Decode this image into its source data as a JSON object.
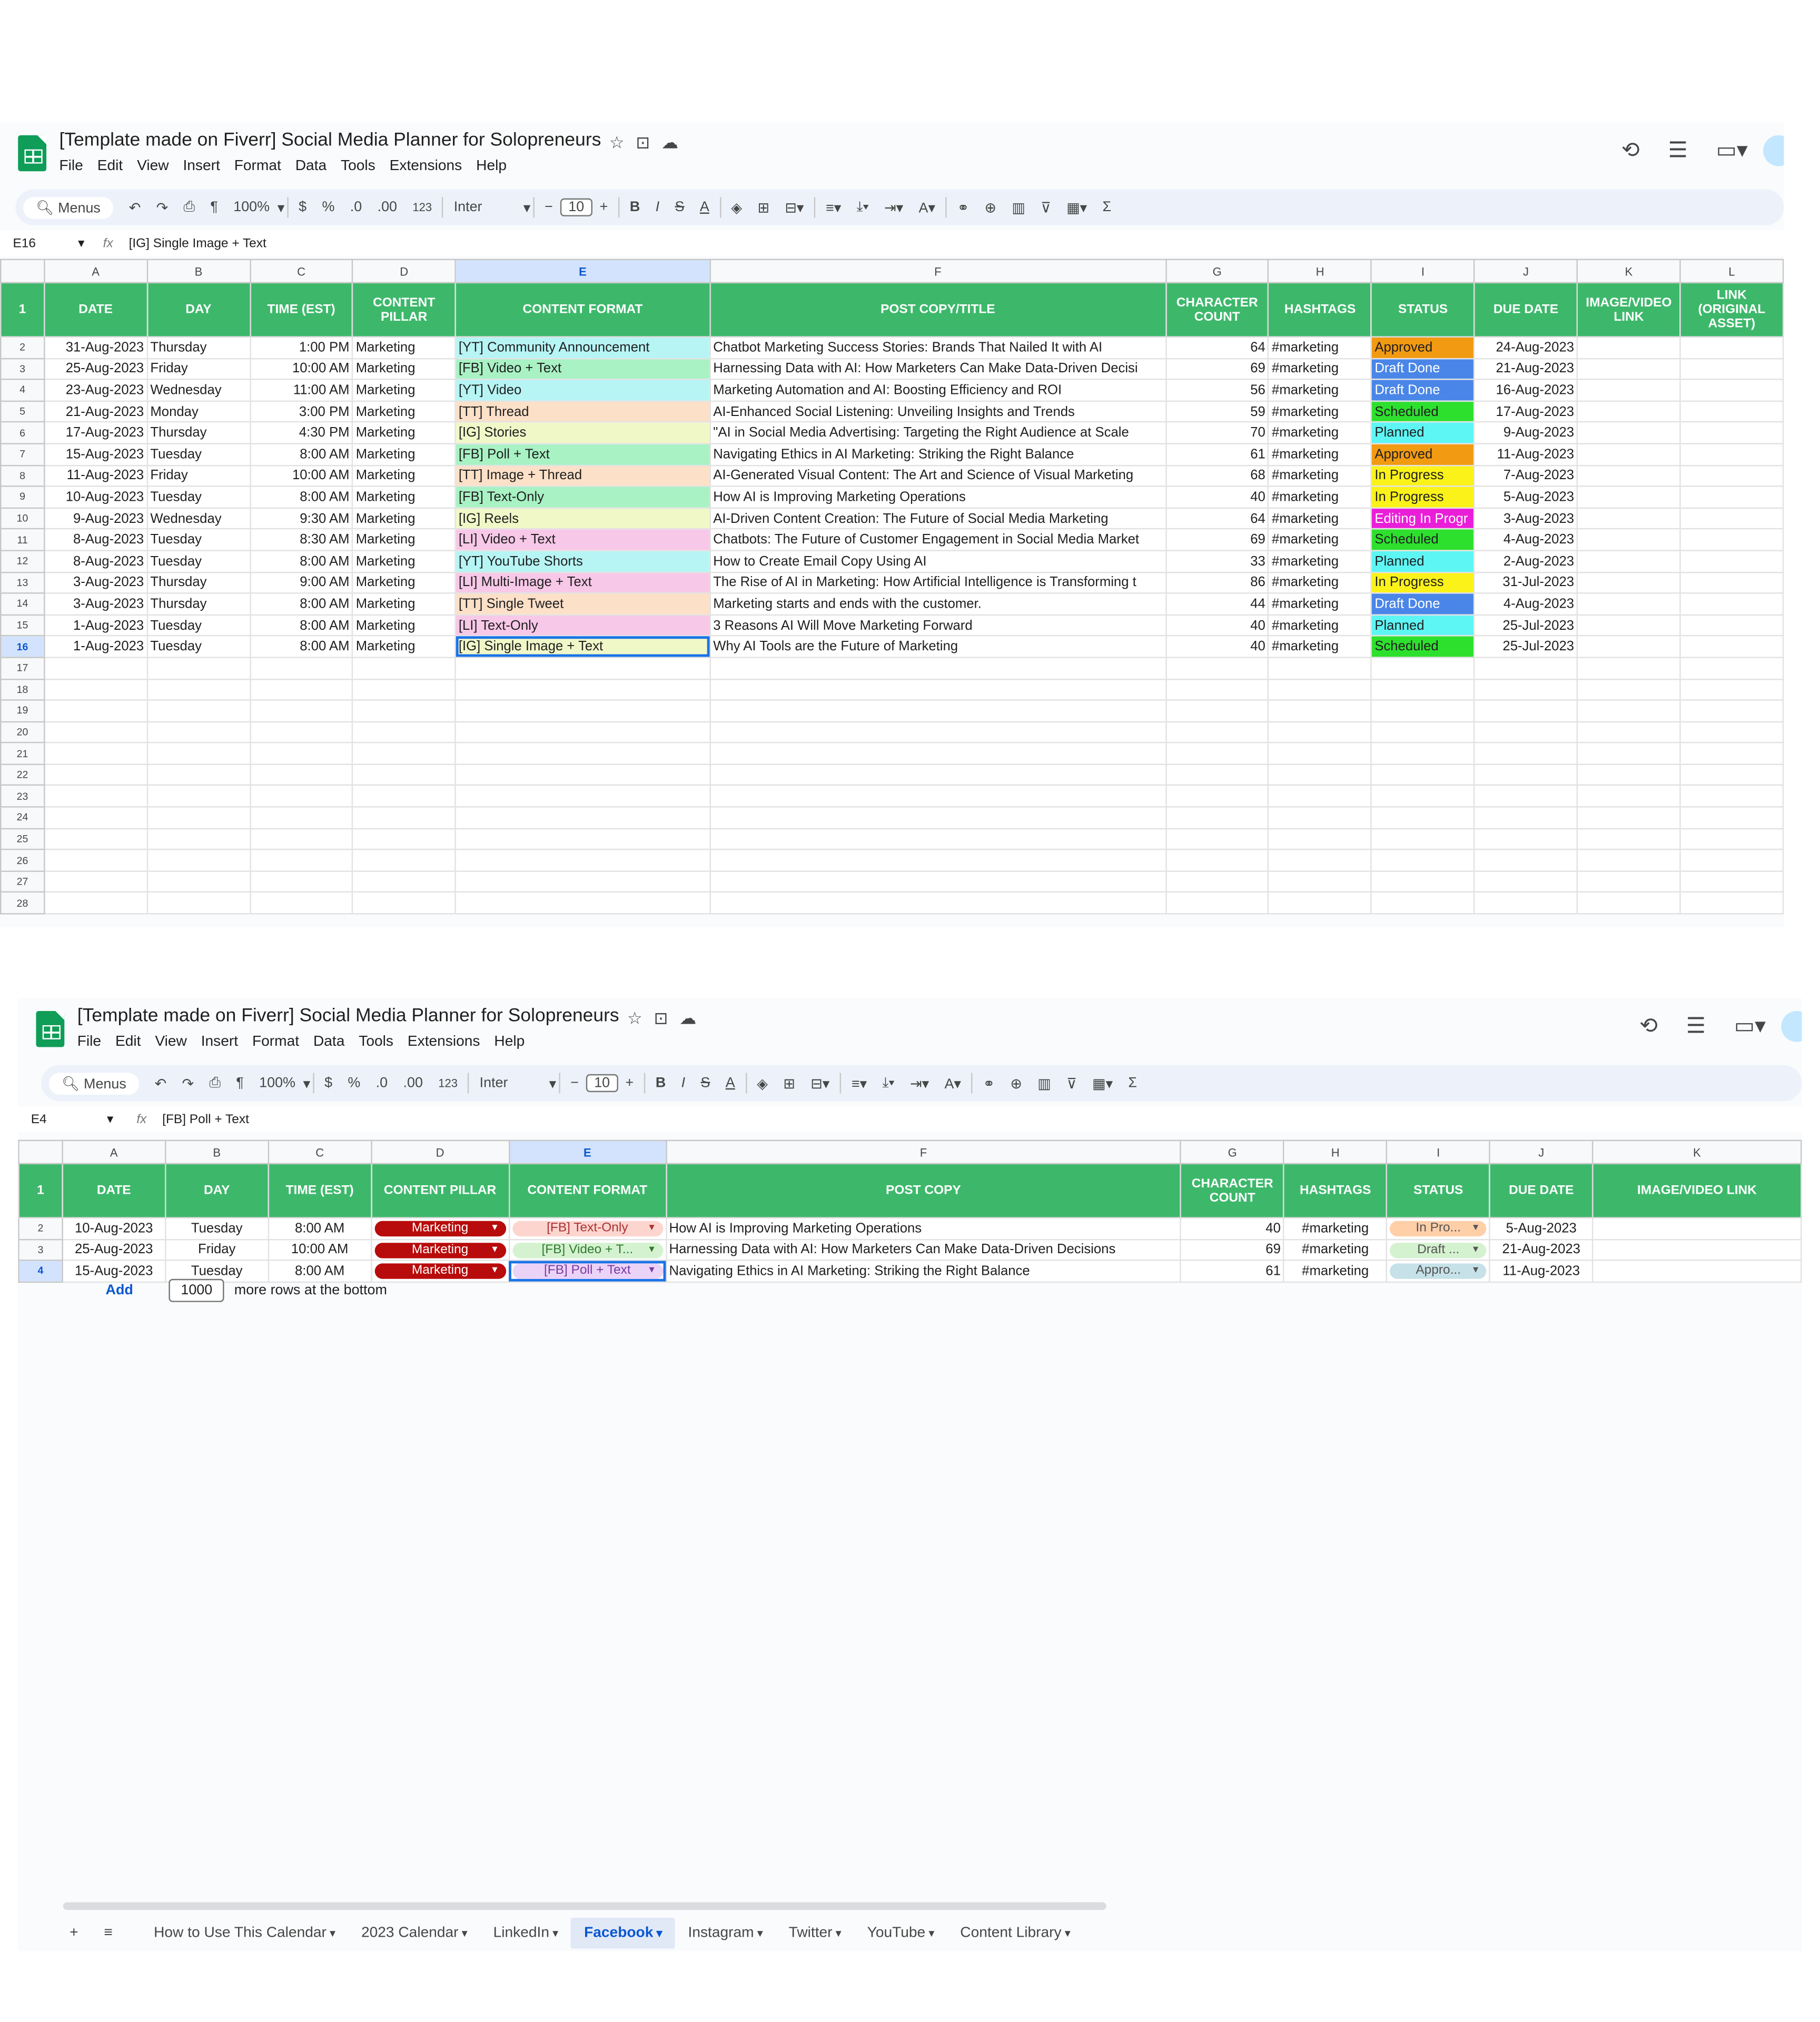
{
  "doc_title": "[Template made on Fiverr] Social Media Planner for Solopreneurs",
  "menu": [
    "File",
    "Edit",
    "View",
    "Insert",
    "Format",
    "Data",
    "Tools",
    "Extensions",
    "Help"
  ],
  "toolbar": {
    "search": "Menus",
    "zoom": "100%",
    "currency": "$",
    "percent": "%",
    "dec_less": ".0",
    "dec_more": ".00",
    "num_fmt": "123",
    "font": "Inter",
    "font_size": "10"
  },
  "icons": {
    "title": [
      "star-icon",
      "move-icon",
      "cloud-icon"
    ],
    "right": [
      "history-icon",
      "comment-icon",
      "video-icon"
    ],
    "logo": "sheets-logo"
  },
  "pane1": {
    "name_box": "E16",
    "formula": "[IG] Single Image + Text",
    "columns": [
      "A",
      "B",
      "C",
      "D",
      "E",
      "F",
      "G",
      "H",
      "I",
      "J",
      "K",
      "L"
    ],
    "headers": [
      "DATE",
      "DAY",
      "TIME (EST)",
      "CONTENT PILLAR",
      "CONTENT FORMAT",
      "POST COPY/TITLE",
      "CHARACTER COUNT",
      "HASHTAGS",
      "STATUS",
      "DUE DATE",
      "IMAGE/VIDEO LINK",
      "LINK (ORIGINAL ASSET)"
    ],
    "rows": [
      {
        "date": "31-Aug-2023",
        "day": "Thursday",
        "time": "1:00 PM",
        "pillar": "Marketing",
        "format": "[YT] Community Announcement",
        "copy": "Chatbot Marketing Success Stories: Brands That Nailed It with AI",
        "count": "64",
        "tags": "#marketing",
        "status": "Approved",
        "due": "24-Aug-2023"
      },
      {
        "date": "25-Aug-2023",
        "day": "Friday",
        "time": "10:00 AM",
        "pillar": "Marketing",
        "format": "[FB] Video + Text",
        "copy": "Harnessing Data with AI: How Marketers Can Make Data-Driven Decisi",
        "count": "69",
        "tags": "#marketing",
        "status": "Draft Done",
        "due": "21-Aug-2023"
      },
      {
        "date": "23-Aug-2023",
        "day": "Wednesday",
        "time": "11:00 AM",
        "pillar": "Marketing",
        "format": "[YT] Video",
        "copy": "Marketing Automation and AI: Boosting Efficiency and ROI",
        "count": "56",
        "tags": "#marketing",
        "status": "Draft Done",
        "due": "16-Aug-2023"
      },
      {
        "date": "21-Aug-2023",
        "day": "Monday",
        "time": "3:00 PM",
        "pillar": "Marketing",
        "format": "[TT] Thread",
        "copy": "AI-Enhanced Social Listening: Unveiling Insights and Trends",
        "count": "59",
        "tags": "#marketing",
        "status": "Scheduled",
        "due": "17-Aug-2023"
      },
      {
        "date": "17-Aug-2023",
        "day": "Thursday",
        "time": "4:30 PM",
        "pillar": "Marketing",
        "format": "[IG] Stories",
        "copy": "\"AI in Social Media Advertising: Targeting the Right Audience at Scale",
        "count": "70",
        "tags": "#marketing",
        "status": "Planned",
        "due": "9-Aug-2023"
      },
      {
        "date": "15-Aug-2023",
        "day": "Tuesday",
        "time": "8:00 AM",
        "pillar": "Marketing",
        "format": "[FB] Poll + Text",
        "copy": "Navigating Ethics in AI Marketing: Striking the Right Balance",
        "count": "61",
        "tags": "#marketing",
        "status": "Approved",
        "due": "11-Aug-2023"
      },
      {
        "date": "11-Aug-2023",
        "day": "Friday",
        "time": "10:00 AM",
        "pillar": "Marketing",
        "format": "[TT] Image + Thread",
        "copy": "AI-Generated Visual Content: The Art and Science of Visual Marketing",
        "count": "68",
        "tags": "#marketing",
        "status": "In Progress",
        "due": "7-Aug-2023"
      },
      {
        "date": "10-Aug-2023",
        "day": "Tuesday",
        "time": "8:00 AM",
        "pillar": "Marketing",
        "format": "[FB] Text-Only",
        "copy": "How AI is Improving Marketing Operations",
        "count": "40",
        "tags": "#marketing",
        "status": "In Progress",
        "due": "5-Aug-2023"
      },
      {
        "date": "9-Aug-2023",
        "day": "Wednesday",
        "time": "9:30 AM",
        "pillar": "Marketing",
        "format": "[IG] Reels",
        "copy": "AI-Driven Content Creation: The Future of Social Media Marketing",
        "count": "64",
        "tags": "#marketing",
        "status": "Editing In Progr",
        "due": "3-Aug-2023"
      },
      {
        "date": "8-Aug-2023",
        "day": "Tuesday",
        "time": "8:30 AM",
        "pillar": "Marketing",
        "format": "[LI] Video + Text",
        "copy": "Chatbots: The Future of Customer Engagement in Social Media Market",
        "count": "69",
        "tags": "#marketing",
        "status": "Scheduled",
        "due": "4-Aug-2023"
      },
      {
        "date": "8-Aug-2023",
        "day": "Tuesday",
        "time": "8:00 AM",
        "pillar": "Marketing",
        "format": "[YT] YouTube Shorts",
        "copy": "How to Create Email Copy Using AI",
        "count": "33",
        "tags": "#marketing",
        "status": "Planned",
        "due": "2-Aug-2023"
      },
      {
        "date": "3-Aug-2023",
        "day": "Thursday",
        "time": "9:00 AM",
        "pillar": "Marketing",
        "format": "[LI] Multi-Image + Text",
        "copy": "The Rise of AI in Marketing: How Artificial Intelligence is Transforming t",
        "count": "86",
        "tags": "#marketing",
        "status": "In Progress",
        "due": "31-Jul-2023"
      },
      {
        "date": "3-Aug-2023",
        "day": "Thursday",
        "time": "8:00 AM",
        "pillar": "Marketing",
        "format": "[TT] Single Tweet",
        "copy": "Marketing starts and ends with the customer.",
        "count": "44",
        "tags": "#marketing",
        "status": "Draft Done",
        "due": "4-Aug-2023"
      },
      {
        "date": "1-Aug-2023",
        "day": "Tuesday",
        "time": "8:00 AM",
        "pillar": "Marketing",
        "format": "[LI] Text-Only",
        "copy": "3 Reasons AI Will Move Marketing Forward",
        "count": "40",
        "tags": "#marketing",
        "status": "Planned",
        "due": "25-Jul-2023"
      },
      {
        "date": "1-Aug-2023",
        "day": "Tuesday",
        "time": "8:00 AM",
        "pillar": "Marketing",
        "format": "[IG] Single Image + Text",
        "copy": "Why AI Tools are the Future of Marketing",
        "count": "40",
        "tags": "#marketing",
        "status": "Scheduled",
        "due": "25-Jul-2023"
      }
    ],
    "empty_rows": [
      "17",
      "18",
      "19",
      "20",
      "21",
      "22",
      "23",
      "24",
      "25",
      "26",
      "27",
      "28"
    ],
    "format_colors": {
      "YT": "#b7f5f5",
      "FB": "#a8f2c4",
      "TT": "#fde0c8",
      "IG": "#f1f8c8",
      "LI": "#f8c8e8"
    },
    "status_colors": {
      "Approved": "#f29a12",
      "Draft Done": "#4a86e8",
      "Scheduled": "#2ee02e",
      "Planned": "#5ef5f5",
      "In Progress": "#fbf21a",
      "Editing In Progr": "#ea1ed8"
    }
  },
  "pane2": {
    "name_box": "E4",
    "formula": "[FB] Poll + Text",
    "columns": [
      "A",
      "B",
      "C",
      "D",
      "E",
      "F",
      "G",
      "H",
      "I",
      "J",
      "K"
    ],
    "headers": [
      "DATE",
      "DAY",
      "TIME (EST)",
      "CONTENT PILLAR",
      "CONTENT FORMAT",
      "POST COPY",
      "CHARACTER COUNT",
      "HASHTAGS",
      "STATUS",
      "DUE DATE",
      "IMAGE/VIDEO LINK"
    ],
    "rows": [
      {
        "date": "10-Aug-2023",
        "day": "Tuesday",
        "time": "8:00 AM",
        "pillar": "Marketing",
        "format": "[FB] Text-Only",
        "copy": "How AI is Improving Marketing Operations",
        "count": "40",
        "tags": "#marketing",
        "status": "In Pro...",
        "due": "5-Aug-2023"
      },
      {
        "date": "25-Aug-2023",
        "day": "Friday",
        "time": "10:00 AM",
        "pillar": "Marketing",
        "format": "[FB] Video + T...",
        "copy": "Harnessing Data with AI: How Marketers Can Make Data-Driven Decisions",
        "count": "69",
        "tags": "#marketing",
        "status": "Draft ...",
        "due": "21-Aug-2023"
      },
      {
        "date": "15-Aug-2023",
        "day": "Tuesday",
        "time": "8:00 AM",
        "pillar": "Marketing",
        "format": "[FB] Poll + Text",
        "copy": "Navigating Ethics in AI Marketing: Striking the Right Balance",
        "count": "61",
        "tags": "#marketing",
        "status": "Appro...",
        "due": "11-Aug-2023"
      }
    ],
    "format_chip_colors": [
      "#fdd5cf",
      "#d4f2cf",
      "#ebd3f7"
    ],
    "status_chip_colors": [
      "#ffcfa8",
      "#d4f2cf",
      "#c6e2e8"
    ],
    "pillar_color": "#b80b0b",
    "add_label": "Add",
    "add_rows": "1000",
    "add_suffix": "more rows at the bottom",
    "sheet_tabs": [
      {
        "label": "How to Use This Calendar",
        "active": false
      },
      {
        "label": "2023 Calendar",
        "active": false
      },
      {
        "label": "LinkedIn",
        "active": false
      },
      {
        "label": "Facebook",
        "active": true
      },
      {
        "label": "Instagram",
        "active": false
      },
      {
        "label": "Twitter",
        "active": false
      },
      {
        "label": "YouTube",
        "active": false
      },
      {
        "label": "Content Library",
        "active": false
      }
    ]
  },
  "accent_colors": {
    "header_green": "#3db86b",
    "selection_blue": "#1a73e8"
  }
}
